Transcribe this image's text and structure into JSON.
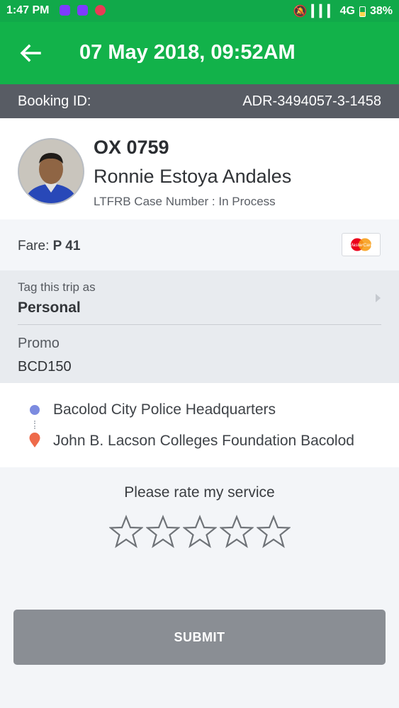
{
  "status_bar": {
    "time": "1:47 PM",
    "network": "4G",
    "battery": "38%"
  },
  "app_bar": {
    "title": "07 May 2018, 09:52AM",
    "back_icon": "arrow-left-icon"
  },
  "booking": {
    "label": "Booking ID:",
    "id": "ADR-3494057-3-1458"
  },
  "driver": {
    "plate": "OX 0759",
    "name": "Ronnie Estoya Andales",
    "ltfrb": "LTFRB Case Number : In Process"
  },
  "fare": {
    "label": "Fare:",
    "amount": "P 41",
    "payment_card": "MasterCard"
  },
  "trip_tag": {
    "label": "Tag this trip as",
    "value": "Personal"
  },
  "promo": {
    "label": "Promo",
    "code": "BCD150"
  },
  "route": {
    "pickup": "Bacolod City Police Headquarters",
    "dropoff": "John B. Lacson Colleges Foundation Bacolod"
  },
  "rating": {
    "prompt": "Please rate my service",
    "value": 0,
    "max": 5
  },
  "submit_label": "SUBMIT",
  "colors": {
    "brand_green": "#12b24a",
    "booking_bar": "#585c64",
    "pickup_dot": "#7c8be0",
    "dropoff_pin": "#ee6a4a",
    "submit_button": "#8a8e94"
  }
}
